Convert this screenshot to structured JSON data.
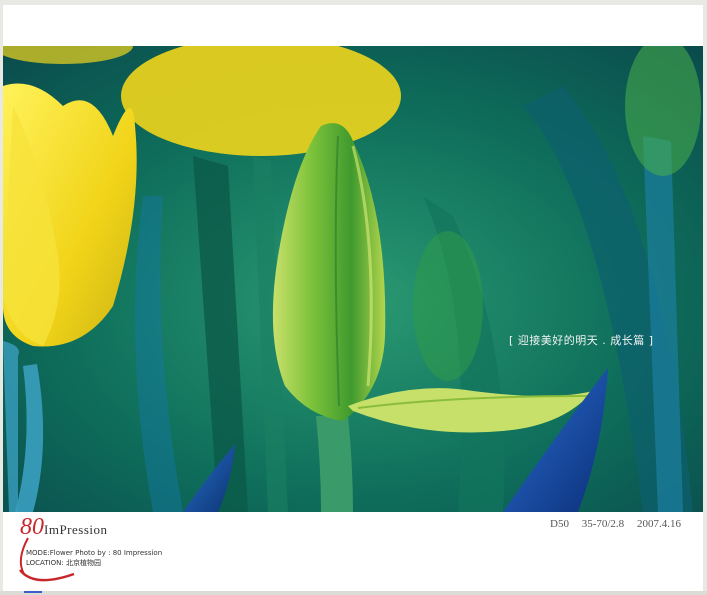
{
  "photo": {
    "caption": "[ 迎接美好的明天 . 成长篇 ]",
    "subject": "tulip-bud-photo"
  },
  "exif": {
    "camera": "D50",
    "lens": "35-70/2.8",
    "date": "2007.4.16"
  },
  "logo": {
    "mark": "80",
    "word": "ImPression",
    "line1": "MODE:Flower  Photo by : 80 Impression",
    "line2": "LOCATION: 北京植物园"
  },
  "colors": {
    "tulip_yellow": "#f2dc1a",
    "leaf_green": "#1e8a4a",
    "background_teal": "#0f6f61",
    "logo_red": "#c9262b"
  }
}
